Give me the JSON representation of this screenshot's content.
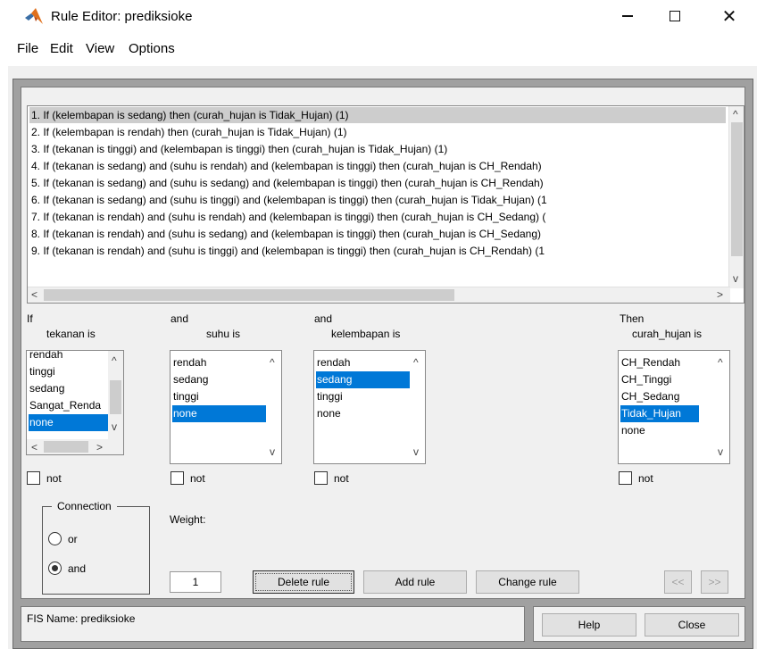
{
  "window": {
    "title": "Rule Editor: prediksioke",
    "controls": {
      "minimize": "—",
      "close": "✕"
    }
  },
  "menu": [
    "File",
    "Edit",
    "View",
    "Options"
  ],
  "rules": [
    "1. If (kelembapan is sedang) then (curah_hujan is Tidak_Hujan) (1)",
    "2. If (kelembapan is rendah) then (curah_hujan is Tidak_Hujan) (1)",
    "3. If (tekanan is tinggi) and (kelembapan is tinggi) then (curah_hujan is Tidak_Hujan) (1)",
    "4. If (tekanan is sedang) and (suhu is rendah) and (kelembapan is tinggi) then (curah_hujan is CH_Rendah)",
    "5. If (tekanan is sedang) and (suhu is sedang) and (kelembapan is tinggi) then (curah_hujan is CH_Rendah)",
    "6. If (tekanan is sedang) and (suhu is tinggi) and (kelembapan is tinggi) then (curah_hujan is Tidak_Hujan) (1",
    "7. If (tekanan is rendah) and (suhu is rendah) and (kelembapan is tinggi) then (curah_hujan is CH_Sedang) (",
    "8. If (tekanan is rendah) and (suhu is sedang) and (kelembapan is tinggi) then (curah_hujan is CH_Sedang)",
    "9. If (tekanan is rendah) and (suhu is tinggi) and (kelembapan is tinggi) then (curah_hujan is CH_Rendah) (1"
  ],
  "selected_rule_index": 0,
  "antecedents": [
    {
      "prefix": "If",
      "variable": "tekanan is",
      "items": [
        "rendah",
        "tinggi",
        "sedang",
        "Sangat_Renda",
        "none"
      ],
      "selected": 4,
      "not_label": "not"
    },
    {
      "prefix": "and",
      "variable": "suhu is",
      "items": [
        "rendah",
        "sedang",
        "tinggi",
        "none"
      ],
      "selected": 3,
      "not_label": "not"
    },
    {
      "prefix": "and",
      "variable": "kelembapan is",
      "items": [
        "rendah",
        "sedang",
        "tinggi",
        "none"
      ],
      "selected": 1,
      "not_label": "not"
    }
  ],
  "consequent": {
    "prefix": "Then",
    "variable": "curah_hujan is",
    "items": [
      "CH_Rendah",
      "CH_Tinggi",
      "CH_Sedang",
      "Tidak_Hujan",
      "none"
    ],
    "selected": 3,
    "not_label": "not"
  },
  "connection": {
    "title": "Connection",
    "options": [
      "or",
      "and"
    ],
    "selected": "and"
  },
  "weight": {
    "label": "Weight:",
    "value": "1"
  },
  "buttons": {
    "delete_rule": "Delete rule",
    "add_rule": "Add rule",
    "change_rule": "Change rule",
    "prev": "<<",
    "next": ">>",
    "help": "Help",
    "close": "Close"
  },
  "status": {
    "fis_name": "FIS Name: prediksioke"
  },
  "colors": {
    "selection": "#0078d7",
    "figure_bg": "#a0a0a0",
    "panel_bg": "#f0f0f0"
  }
}
